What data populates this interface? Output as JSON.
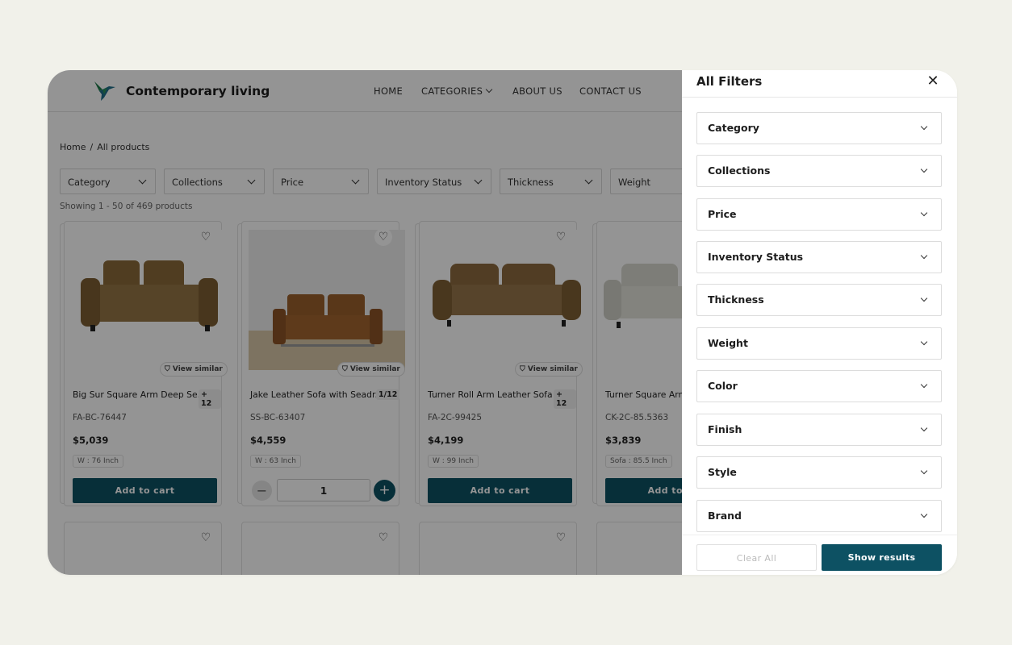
{
  "brand": {
    "name": "Contemporary living",
    "accent": "#0d5163"
  },
  "nav": [
    "HOME",
    "CATEGORIES",
    "ABOUT US",
    "CONTACT US"
  ],
  "breadcrumb": {
    "home": "Home",
    "separator": "/",
    "current": "All products"
  },
  "filter_chips": [
    "Category",
    "Collections",
    "Price",
    "Inventory Status",
    "Thickness",
    "Weight"
  ],
  "showing": "Showing 1 - 50 of 469 products",
  "products": [
    {
      "name": "Big Sur Square Arm Deep Se...",
      "count": "+ 12",
      "view_similar": "View similar",
      "sku": "FA-BC-76447",
      "price": "$5,039",
      "dim": "W : 76 Inch",
      "action": "Add to cart"
    },
    {
      "name": "Jake Leather Sofa with Seadr...",
      "count": "1/12",
      "view_similar": "View similar",
      "sku": "SS-BC-63407",
      "price": "$4,559",
      "dim": "W : 63 Inch",
      "quantity": "1"
    },
    {
      "name": "Turner Roll Arm Leather Sofa",
      "count": "+ 12",
      "view_similar": "View similar",
      "sku": "FA-2C-99425",
      "price": "$4,199",
      "dim": "W : 99 Inch",
      "action": "Add to cart"
    },
    {
      "name": "Turner Square Arm",
      "sku": "CK-2C-85.5363",
      "price": "$3,839",
      "dim": "Sofa : 85.5 Inch",
      "action": "Add to cart"
    }
  ],
  "drawer": {
    "title": "All Filters",
    "facets": [
      "Category",
      "Collections",
      "Price",
      "Inventory Status",
      "Thickness",
      "Weight",
      "Color",
      "Finish",
      "Style",
      "Brand"
    ],
    "clear_label": "Clear All",
    "show_label": "Show results"
  }
}
